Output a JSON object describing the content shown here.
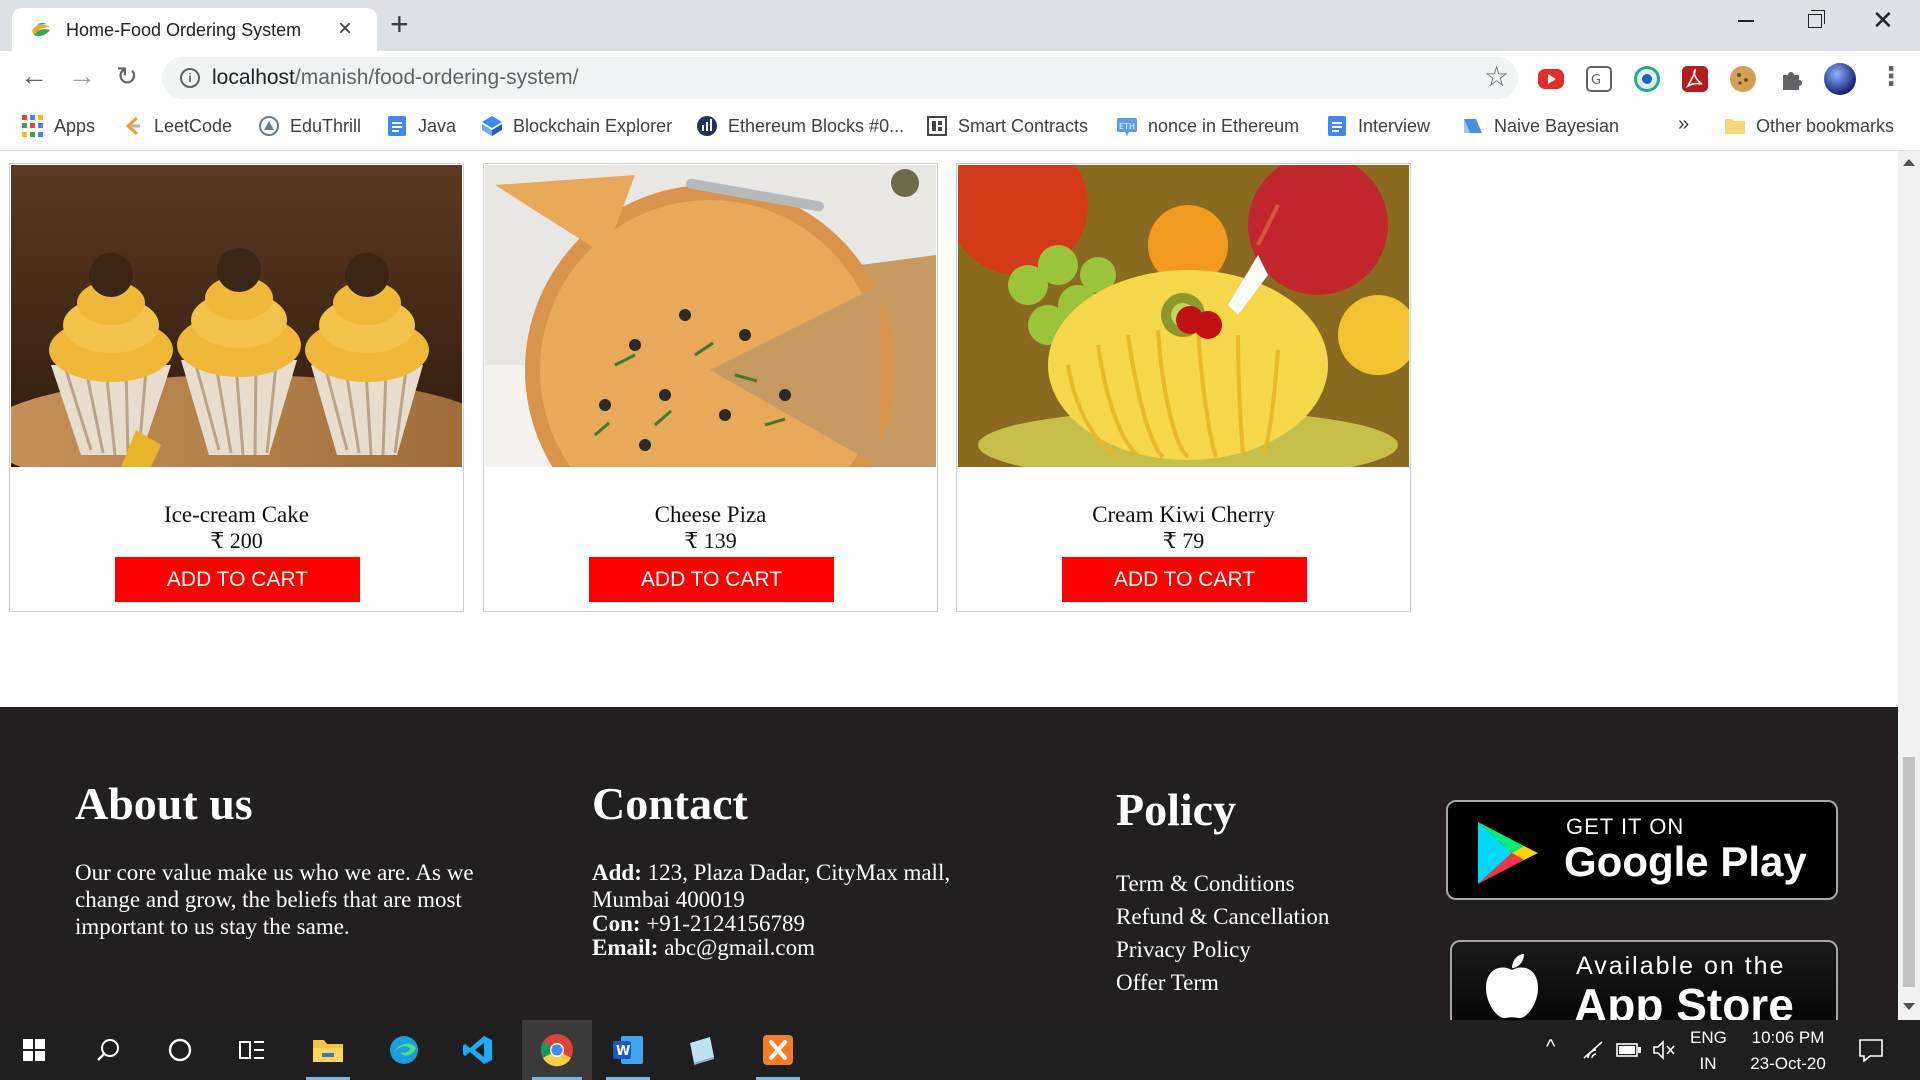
{
  "browser": {
    "tab_title": "Home-Food Ordering System",
    "url_host": "localhost",
    "url_path": "/manish/food-ordering-system/",
    "bookmarks": [
      {
        "label": "Apps",
        "icon": "apps-grid-icon",
        "color": "#4285f4"
      },
      {
        "label": "LeetCode",
        "icon": "leetcode-icon",
        "color": "#f89f1b"
      },
      {
        "label": "EduThrill",
        "icon": "eduthrill-icon",
        "color": "#6b7b8c"
      },
      {
        "label": "Java",
        "icon": "doc-icon",
        "color": "#4285f4"
      },
      {
        "label": "Blockchain Explorer",
        "icon": "blockchain-icon",
        "color": "#3d89f5"
      },
      {
        "label": "Ethereum Blocks #0...",
        "icon": "etherscan-icon",
        "color": "#21325b"
      },
      {
        "label": "Smart Contracts",
        "icon": "contract-icon",
        "color": "#444444"
      },
      {
        "label": "nonce in Ethereum",
        "icon": "eth-icon",
        "color": "#5d9cec"
      },
      {
        "label": "Interview",
        "icon": "doc-icon",
        "color": "#4285f4"
      },
      {
        "label": "Naive Bayesian",
        "icon": "bayes-icon",
        "color": "#4a90e2"
      }
    ],
    "bookmarks_more": "»",
    "other_bookmarks": "Other bookmarks"
  },
  "products": [
    {
      "name": "Ice-cream Cake",
      "price": "₹ 200",
      "button": "ADD TO CART",
      "image": "cupcakes-photo"
    },
    {
      "name": "Cheese Piza",
      "price": "₹ 139",
      "button": "ADD TO CART",
      "image": "pizza-photo"
    },
    {
      "name": "Cream Kiwi Cherry",
      "price": "₹ 79",
      "button": "ADD TO CART",
      "image": "fruit-cake-photo"
    }
  ],
  "footer": {
    "about_title": "About us",
    "about_text": "Our core value make us who we are. As we change and grow, the beliefs that are most important to us stay the same.",
    "contact_title": "Contact",
    "contact_add_label": "Add:",
    "contact_add": "123, Plaza Dadar, CityMax mall, Mumbai 400019",
    "contact_con_label": "Con:",
    "contact_con": "+91-2124156789",
    "contact_email_label": "Email:",
    "contact_email": "abc@gmail.com",
    "policy_title": "Policy",
    "policy_links": [
      "Term & Conditions",
      "Refund & Cancellation",
      "Privacy Policy",
      "Offer Term"
    ],
    "google_play_small": "GET IT ON",
    "google_play_big": "Google Play",
    "app_store_small": "Available on the",
    "app_store_big": "App Store"
  },
  "taskbar": {
    "lang_top": "ENG",
    "lang_bottom": "IN",
    "time": "10:06 PM",
    "date": "23-Oct-20"
  },
  "colors": {
    "cart_button": "#ff0000",
    "footer_bg": "#231f20"
  }
}
